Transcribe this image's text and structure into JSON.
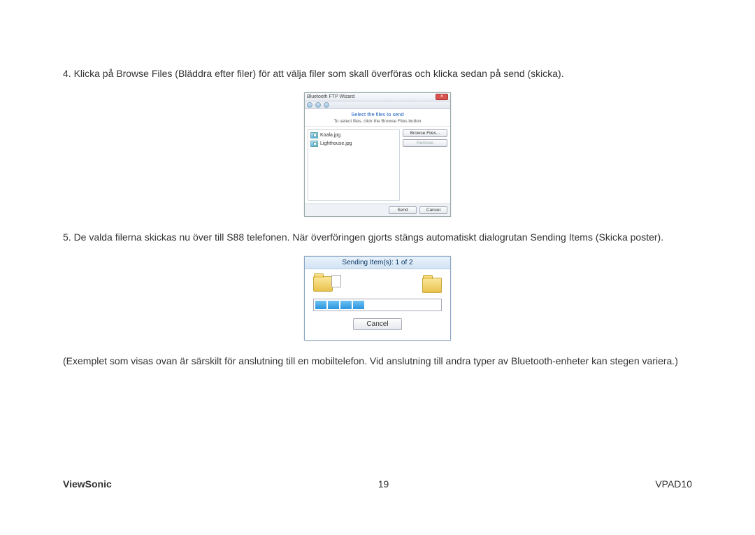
{
  "body": {
    "step4": "4. Klicka på Browse Files (Bläddra efter filer) för att välja filer som skall överföras och klicka sedan på send (skicka).",
    "step5": "5. De valda filerna skickas nu över till S88 telefonen. När överföringen gjorts stängs automatiskt dialogrutan Sending Items (Skicka poster).",
    "note": "(Exemplet som visas ovan är särskilt för anslutning till en mobiltelefon. Vid anslutning till andra typer av Bluetooth-enheter kan stegen variera.)"
  },
  "wizard": {
    "title": "Bluetooth FTP Wizard",
    "close_glyph": "✕",
    "heading": "Select the files to send",
    "subheading": "To select files, click the Browse Files button",
    "files": [
      "Koala.jpg",
      "Lighthouse.jpg"
    ],
    "browse_label": "Browse Files...",
    "remove_label": "Remove",
    "send_label": "Send",
    "cancel_label": "Cancel"
  },
  "sending": {
    "title": "Sending Item(s): 1 of 2",
    "cancel_label": "Cancel",
    "progress_of_total": 4
  },
  "footer": {
    "brand": "ViewSonic",
    "page": "19",
    "model": "VPAD10"
  }
}
